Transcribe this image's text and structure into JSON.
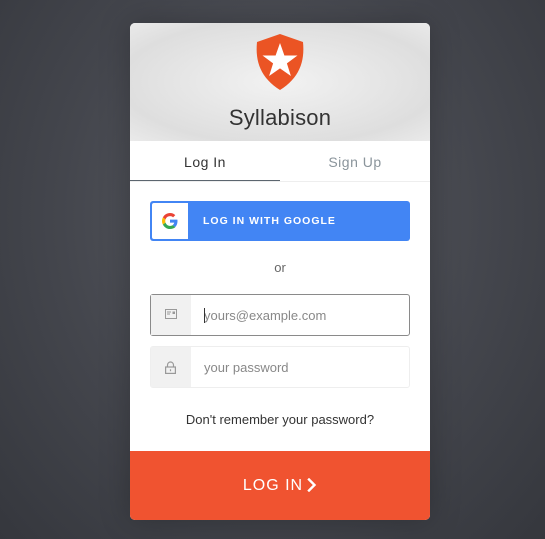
{
  "app": {
    "title": "Syllabison"
  },
  "tabs": [
    {
      "label": "Log In",
      "active": true
    },
    {
      "label": "Sign Up",
      "active": false
    }
  ],
  "social": {
    "google_label": "LOG IN WITH GOOGLE",
    "icon": "google-icon"
  },
  "divider": {
    "text": "or"
  },
  "email": {
    "placeholder": "yours@example.com",
    "value": "",
    "icon": "envelope-icon"
  },
  "password": {
    "placeholder": "your password",
    "value": "",
    "icon": "lock-icon"
  },
  "forgot": {
    "label": "Don't remember your password?"
  },
  "submit": {
    "label": "LOG IN",
    "icon": "chevron-right-icon"
  },
  "colors": {
    "accent": "#f05330",
    "google_blue": "#4285f4",
    "logo": "#eb5424"
  }
}
